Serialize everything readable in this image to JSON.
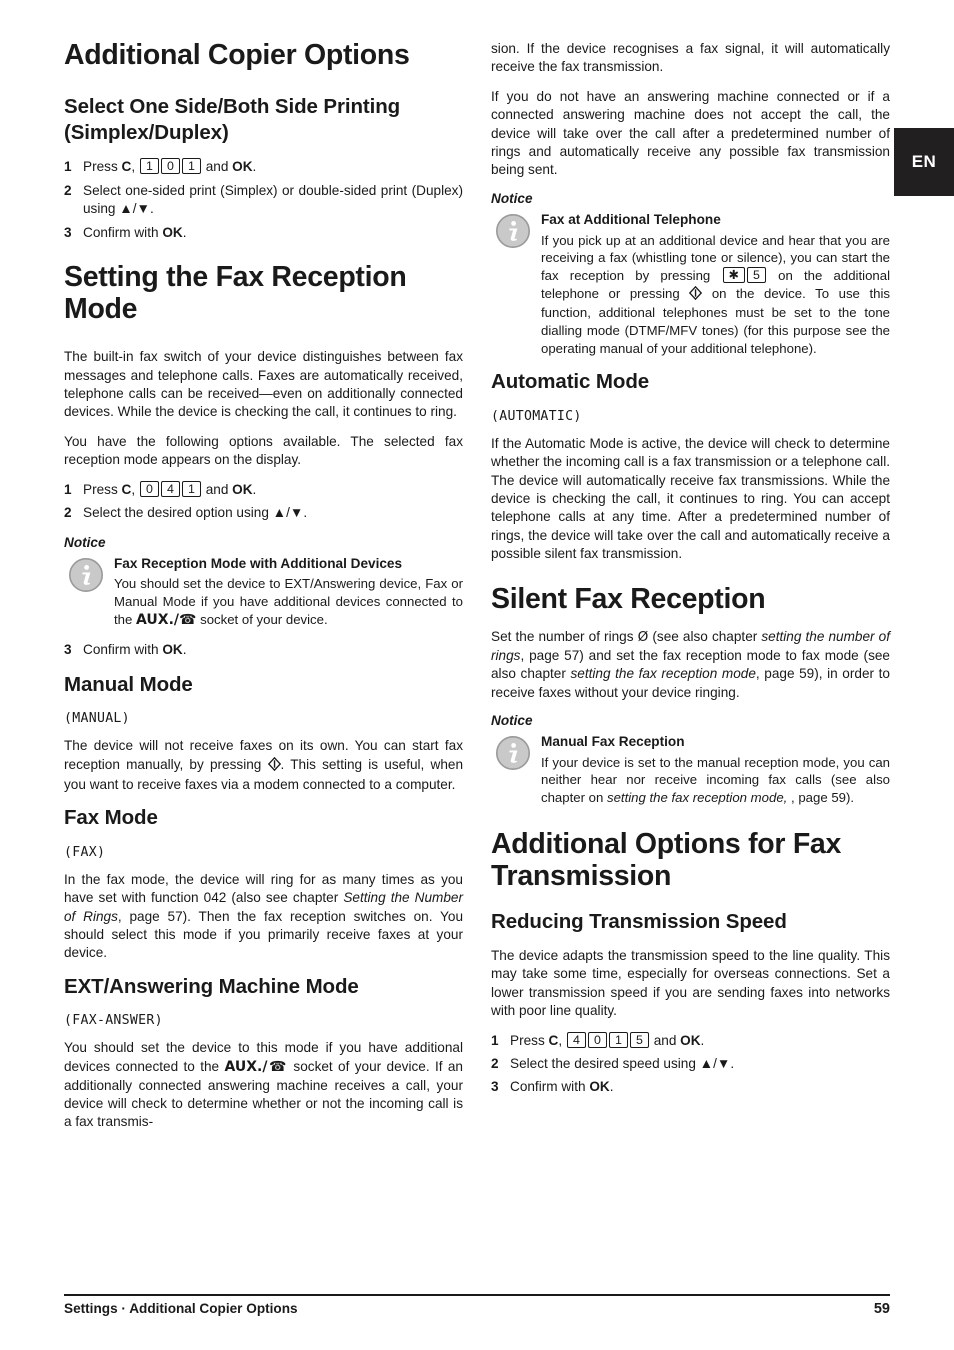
{
  "lang_tab": "EN",
  "left_column": {
    "title": "Additional Copier Options",
    "section1": {
      "heading": "Select One Side/Both Side Printing (Simplex/Duplex)",
      "steps": [
        {
          "num": "1",
          "parts": [
            "Press ",
            "C",
            ", ",
            "KEYS:1,0,1",
            " and ",
            "OK",
            "."
          ]
        },
        {
          "num": "2",
          "text": "Select one-sided print (Simplex) or double-sided print (Duplex) using ▲/▼."
        },
        {
          "num": "3",
          "parts": [
            "Confirm with ",
            "OK",
            "."
          ]
        }
      ]
    },
    "section2": {
      "title": "Setting the Fax Reception Mode",
      "para1": "The built-in fax switch of your device distinguishes between fax messages and telephone calls. Faxes are automatically received, telephone calls can be received—even on additionally connected devices. While the device is checking the call, it continues to ring.",
      "para2": "You have the following options available. The selected fax reception mode appears on the display.",
      "step1_prefix": "Press ",
      "step1_keys": [
        "0",
        "4",
        "1"
      ],
      "step2": "Select the desired option using ▲/▼.",
      "step3": "Confirm with ",
      "notice_label": "Notice",
      "notice_head": "Fax Reception Mode with Additional Devices",
      "notice_body_1": "You should set the device to EXT/Answering device, Fax or Manual Mode if you have additional devices connected to the ",
      "notice_body_aux": "AUX./☎",
      "notice_body_2": " socket of your device."
    },
    "manual_mode": {
      "heading": "Manual Mode",
      "lcd": "(MANUAL)",
      "body_1": "The device will not receive faxes on its own. You can start fax reception manually, by pressing ",
      "body_2": ". This setting is useful, when you want to receive faxes via a modem connected to a computer."
    },
    "fax_mode": {
      "heading": "Fax Mode",
      "lcd": "(FAX)",
      "body_1": "In the fax mode, the device will ring for as many times as you have set with function 042 (also see chapter ",
      "body_italic": "Setting the Number of Rings",
      "body_2": ", page  57). Then the fax reception switches on. You should select this mode if you primarily receive faxes at your device."
    },
    "ext_mode": {
      "heading": "EXT/Answering Machine Mode",
      "lcd": "(FAX-ANSWER)",
      "body_1": "You should set the device to this mode if you have additional devices connected to the ",
      "body_aux": "AUX./☎",
      "body_2": " socket of your device. If an additionally connected answering machine receives a call, your device will check to determine whether or not the incoming call is a fax transmis-"
    }
  },
  "right_column": {
    "para_cont": "sion. If the device recognises a fax signal, it will automatically receive the fax transmission.",
    "para2": "If you do not have an answering machine connected or if a connected answering machine does not accept the call, the device will take over the call after a predetermined number of rings and automatically receive any possible fax transmission being sent.",
    "notice1": {
      "label": "Notice",
      "head": "Fax at Additional Telephone",
      "body_1": "If you pick up at an additional device and hear that you are receiving a fax (whistling tone or silence), you can start the fax reception by pressing ",
      "keys": [
        "✱",
        "5"
      ],
      "body_2": " on the additional telephone or pressing ",
      "body_3": " on the device. To use this function, additional telephones must be set to the tone dialling mode (DTMF/MFV tones) (for this purpose see the operating manual of your additional telephone)."
    },
    "automatic_mode": {
      "heading": "Automatic Mode",
      "lcd": "(AUTOMATIC)",
      "body": "If the Automatic Mode is active, the device will check to determine whether the incoming call is a fax transmission or a telephone call. The device will automatically receive fax transmissions.  While the device is checking the call, it continues to ring. You can accept telephone calls at any time. After a predetermined number of rings, the device will take over the call and automatically receive a possible silent fax transmission."
    },
    "silent_fax": {
      "title": "Silent Fax Reception",
      "body_1": "Set the number of rings ",
      "zero": "Ø",
      "body_2": " (see also chapter  ",
      "italic_1": "setting the number of rings",
      "body_3": ", page   57) and set the fax reception mode to fax mode (see also chapter  ",
      "italic_2": "setting the fax reception mode",
      "body_4": ", page  59),  in order to receive faxes without your device ringing.",
      "notice_label": "Notice",
      "notice_head": "Manual Fax Reception",
      "notice_body_1": "If your device is set to the manual reception mode, you can neither hear nor receive incoming fax calls (see also chapter on ",
      "notice_italic": "setting the fax reception mode,",
      "notice_body_2": " , page  59)."
    },
    "additional_options": {
      "title": "Additional Options for Fax Transmission",
      "heading": "Reducing Transmission Speed",
      "body": "The device adapts the transmission speed to the line quality. This may take some time, especially for overseas connections. Set a lower transmission speed if you are sending faxes into networks with poor line quality.",
      "step1_prefix": "Press ",
      "step1_keys": [
        "4",
        "0",
        "1",
        "5"
      ],
      "step2": "Select the desired speed using ▲/▼.",
      "step3": "Confirm with "
    }
  },
  "common": {
    "key_c": "C",
    "key_ok": "OK",
    "and": " and ",
    "period": ".",
    "comma": ", "
  },
  "footer": {
    "text": "Settings · Additional Copier Options",
    "page": "59"
  }
}
